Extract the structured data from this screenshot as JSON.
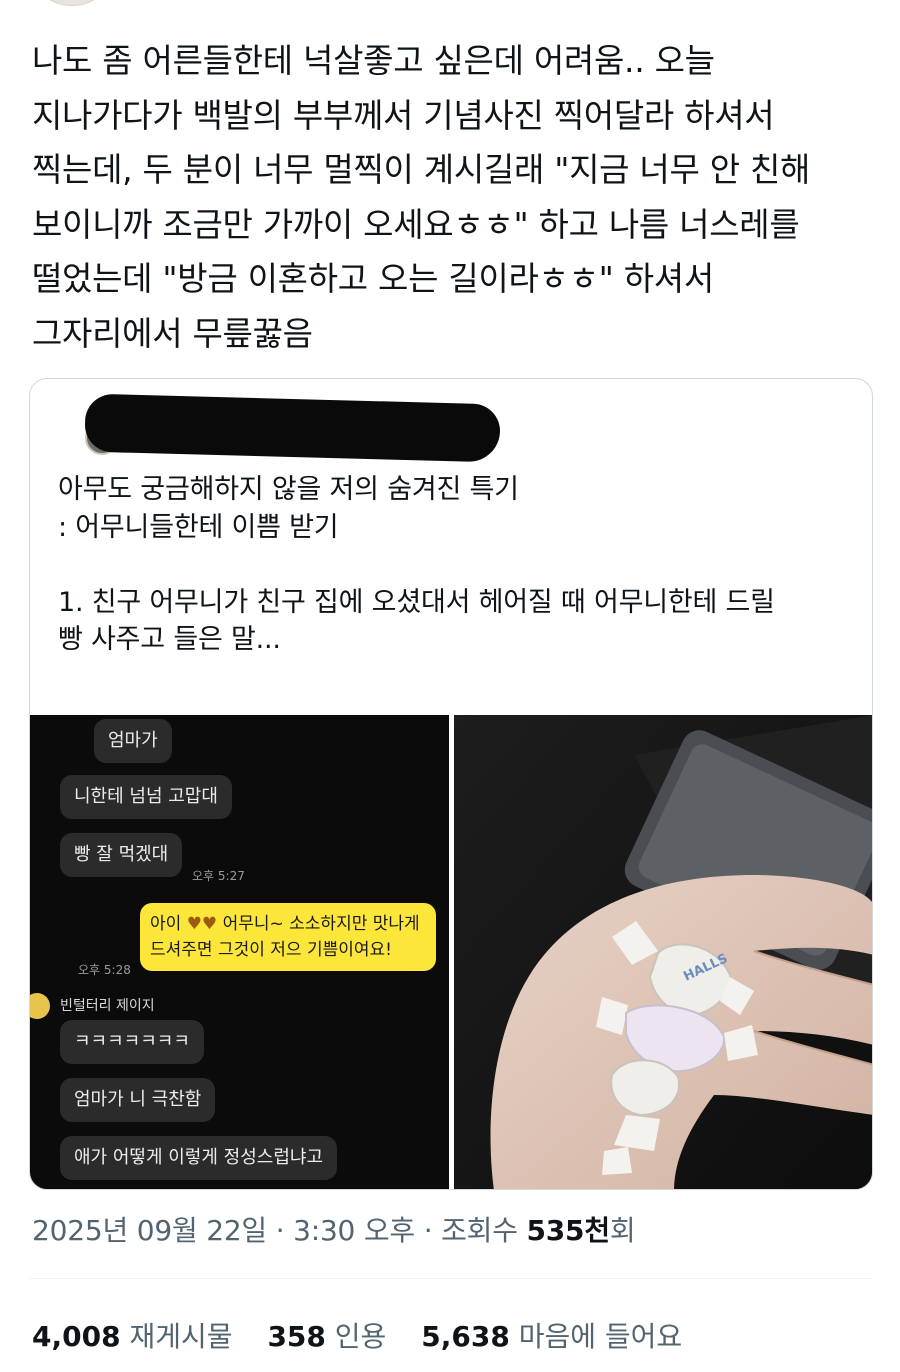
{
  "tweet": {
    "text": "나도 좀 어른들한테 넉살좋고 싶은데 어려움.. 오늘\n지나가다가 백발의 부부께서 기념사진 찍어달라 하셔서\n찍는데, 두 분이 너무 멀찍이 계시길래 \"지금 너무 안 친해\n보이니까 조금만 가까이 오세요ㅎㅎ\" 하고 나름 너스레를\n떨었는데 \"방금 이혼하고 오는 길이라ㅎㅎ\" 하셔서\n그자리에서 무릎꿇음"
  },
  "quote": {
    "text": "아무도 궁금해하지 않을 저의 숨겨진 특기\n: 어무니들한테 이쁨 받기\n\n1. 친구 어무니가 친구 집에 오셨대서 헤어질 때 어무니한테 드릴\n빵 사주고 들은 말..."
  },
  "chat": {
    "msg1": "엄마가",
    "msg2": "니한테 넘넘 고맙대",
    "msg3": "빵 잘 먹겠대",
    "time1": "오후 5:27",
    "mine_a": "아이",
    "mine_b": "어무니~ 소소하지만 맛나게 드셔주면 그것이 저으 기쁨이여요!",
    "time2": "오후 5:28",
    "sender": "빈털터리 제이지",
    "msg4": "ㅋㅋㅋㅋㅋㅋㅋ",
    "msg5": "엄마가 니 극찬함",
    "msg6": "애가 어떻게 이렇게 정성스럽냐고",
    "heart_color": "#9b5c12",
    "mine_bubble_color": "#fde63a"
  },
  "photo": {
    "candy_label": "HALLS"
  },
  "meta": {
    "datetime": "2025년 09월 22일 · 3:30 오후 · 조회수 ",
    "views": "535천",
    "views_suffix": "회"
  },
  "stats": {
    "retweets": "4,008",
    "retweets_label": "재게시물",
    "quotes": "358",
    "quotes_label": "인용",
    "likes": "5,638",
    "likes_label": "마음에 들어요"
  }
}
